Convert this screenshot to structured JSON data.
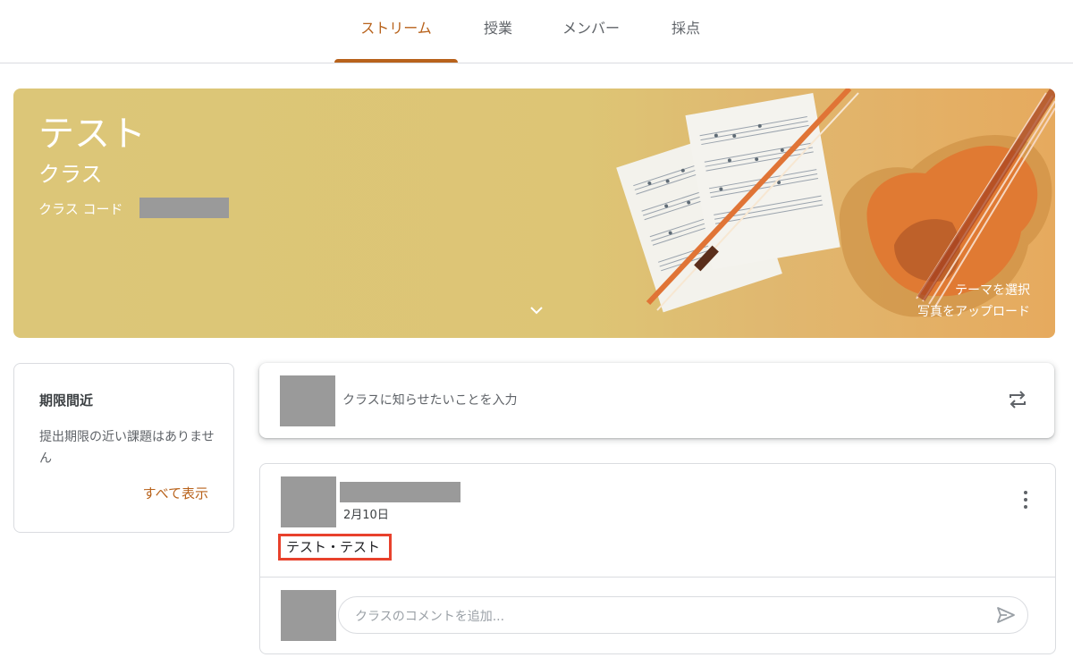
{
  "nav": {
    "tabs": [
      "ストリーム",
      "授業",
      "メンバー",
      "採点"
    ],
    "active": "ストリーム"
  },
  "banner": {
    "title": "テスト",
    "section": "クラス",
    "code_label": "クラス コード",
    "theme_link": "テーマを選択",
    "upload_link": "写真をアップロード"
  },
  "upcoming": {
    "title": "期限間近",
    "text": "提出期限の近い課題はありません",
    "view_all": "すべて表示"
  },
  "announce": {
    "placeholder": "クラスに知らせたいことを入力"
  },
  "post": {
    "date": "2月10日",
    "text": "テスト・テスト",
    "comment_placeholder": "クラスのコメントを追加..."
  },
  "colors": {
    "accent": "#b8621b",
    "highlight_border": "#e8412c",
    "banner": "#dcc678"
  },
  "icons": [
    "chevron-down-icon",
    "repost-icon",
    "more-vert-icon",
    "send-icon"
  ]
}
